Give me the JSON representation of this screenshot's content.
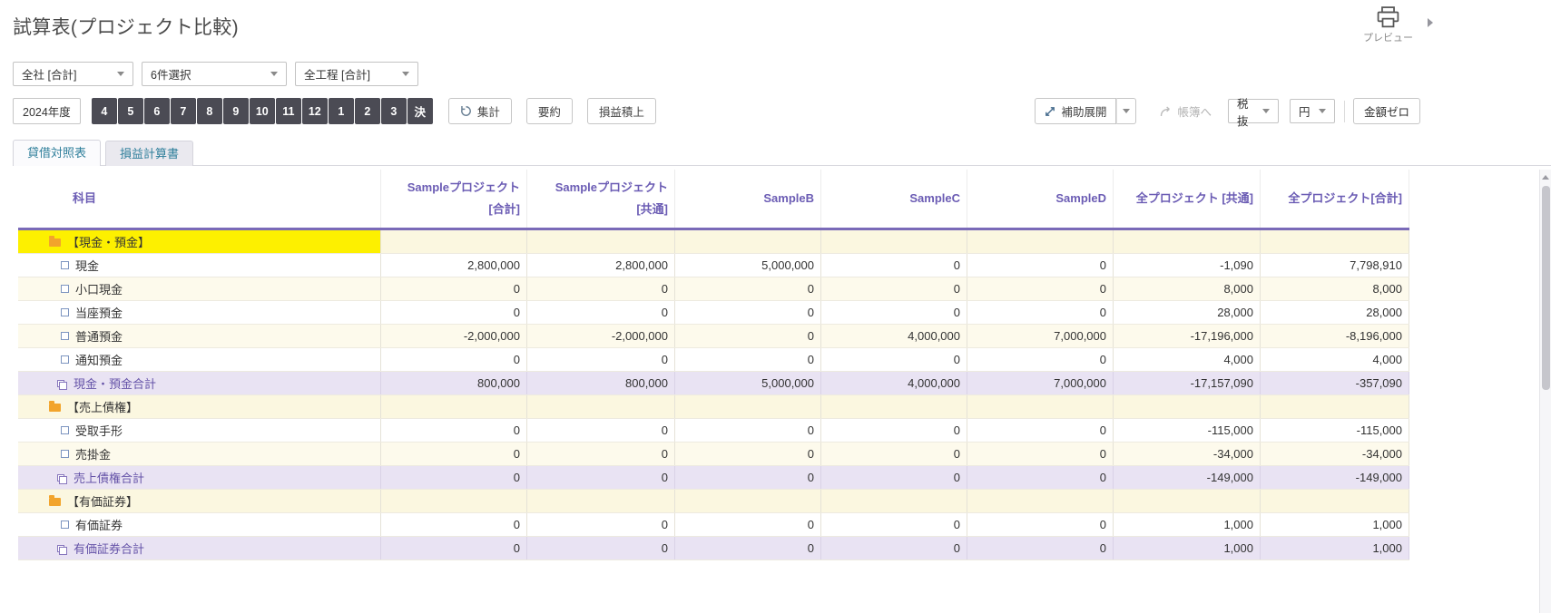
{
  "page": {
    "title": "試算表(プロジェクト比較)"
  },
  "actions": {
    "preview_label": "プレビュー"
  },
  "filters": [
    {
      "value": "全社 [合計]"
    },
    {
      "value": "6件選択"
    },
    {
      "value": "全工程 [合計]"
    }
  ],
  "toolbar": {
    "fiscal_year": "2024年度",
    "months": [
      "4",
      "5",
      "6",
      "7",
      "8",
      "9",
      "10",
      "11",
      "12",
      "1",
      "2",
      "3",
      "決"
    ],
    "aggregate_label": "集計",
    "summary_label": "要約",
    "profit_stack_label": "損益積上",
    "aux_expand_label": "補助展開",
    "ledger_label": "帳簿へ",
    "tax_mode_value": "税抜",
    "unit_value": "円",
    "zero_amount_label": "金額ゼロ"
  },
  "tabs": [
    {
      "label": "貸借対照表",
      "active": true
    },
    {
      "label": "損益計算書",
      "active": false
    }
  ],
  "table": {
    "columns": [
      "科目",
      "Sampleプロジェクト\n[合計]",
      "Sampleプロジェクト\n[共通]",
      "SampleB",
      "SampleC",
      "SampleD",
      "全プロジェクト [共通]",
      "全プロジェクト[合計]"
    ],
    "rows": [
      {
        "type": "section",
        "label": "【現金・預金】",
        "selected": true,
        "values": [
          "",
          "",
          "",
          "",
          "",
          "",
          ""
        ]
      },
      {
        "type": "item",
        "label": "現金",
        "values": [
          "2,800,000",
          "2,800,000",
          "5,000,000",
          "0",
          "0",
          "-1,090",
          "7,798,910"
        ]
      },
      {
        "type": "item",
        "label": "小口現金",
        "values": [
          "0",
          "0",
          "0",
          "0",
          "0",
          "8,000",
          "8,000"
        ]
      },
      {
        "type": "item",
        "label": "当座預金",
        "values": [
          "0",
          "0",
          "0",
          "0",
          "0",
          "28,000",
          "28,000"
        ]
      },
      {
        "type": "item",
        "label": "普通預金",
        "values": [
          "-2,000,000",
          "-2,000,000",
          "0",
          "4,000,000",
          "7,000,000",
          "-17,196,000",
          "-8,196,000"
        ]
      },
      {
        "type": "item",
        "label": "通知預金",
        "values": [
          "0",
          "0",
          "0",
          "0",
          "0",
          "4,000",
          "4,000"
        ]
      },
      {
        "type": "total",
        "label": "現金・預金合計",
        "values": [
          "800,000",
          "800,000",
          "5,000,000",
          "4,000,000",
          "7,000,000",
          "-17,157,090",
          "-357,090"
        ]
      },
      {
        "type": "section",
        "label": "【売上債権】",
        "values": [
          "",
          "",
          "",
          "",
          "",
          "",
          ""
        ]
      },
      {
        "type": "item",
        "label": "受取手形",
        "values": [
          "0",
          "0",
          "0",
          "0",
          "0",
          "-115,000",
          "-115,000"
        ]
      },
      {
        "type": "item",
        "label": "売掛金",
        "values": [
          "0",
          "0",
          "0",
          "0",
          "0",
          "-34,000",
          "-34,000"
        ]
      },
      {
        "type": "total",
        "label": "売上債権合計",
        "values": [
          "0",
          "0",
          "0",
          "0",
          "0",
          "-149,000",
          "-149,000"
        ]
      },
      {
        "type": "section",
        "label": "【有価証券】",
        "values": [
          "",
          "",
          "",
          "",
          "",
          "",
          ""
        ]
      },
      {
        "type": "item",
        "label": "有価証券",
        "values": [
          "0",
          "0",
          "0",
          "0",
          "0",
          "1,000",
          "1,000"
        ]
      },
      {
        "type": "total",
        "label": "有価証券合計",
        "values": [
          "0",
          "0",
          "0",
          "0",
          "0",
          "1,000",
          "1,000"
        ]
      }
    ]
  },
  "colors": {
    "accent_purple": "#6b5cb4",
    "negative_red": "#c40000",
    "selected_yellow": "#fdf000",
    "section_bg": "#fbf7e0",
    "total_bg": "#e9e3f3",
    "month_selected_bg": "#4b4b54"
  }
}
